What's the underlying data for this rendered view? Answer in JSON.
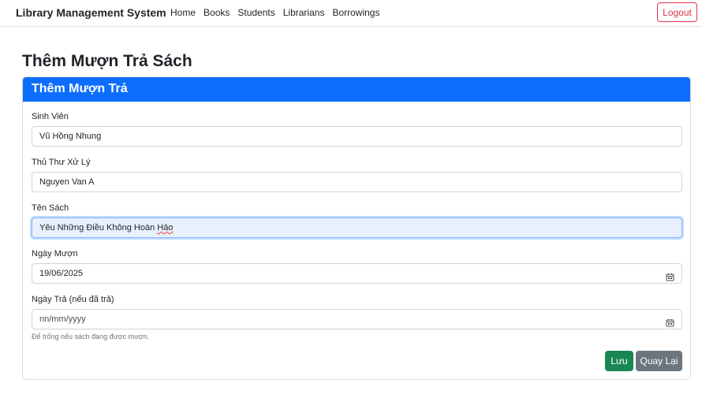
{
  "navbar": {
    "brand": "Library Management System",
    "links": [
      "Home",
      "Books",
      "Students",
      "Librarians",
      "Borrowings"
    ],
    "logout_label": "Logout"
  },
  "page": {
    "title": "Thêm Mượn Trả Sách"
  },
  "form": {
    "header": "Thêm Mượn Trả",
    "student": {
      "label": "Sinh Viên",
      "value": "Vũ Hồng Nhung"
    },
    "librarian": {
      "label": "Thủ Thư Xử Lý",
      "value": "Nguyen Van A"
    },
    "book": {
      "label": "Tên Sách",
      "value_main": "Yêu Những Điều Không Hoàn ",
      "value_misspelled": "Hảo"
    },
    "borrow_date": {
      "label": "Ngày Mượn",
      "value": "19/06/2025"
    },
    "return_date": {
      "label": "Ngày Trả (nếu đã trả)",
      "placeholder": "nn/mm/yyyy",
      "help": "Để trống nếu sách đang được mượn."
    },
    "save_label": "Lưu",
    "back_label": "Quay Lại"
  },
  "colors": {
    "primary": "#0d6efd",
    "success": "#198754",
    "secondary": "#6c757d",
    "danger": "#dc3545"
  },
  "icons": {
    "date_picker": "calendar-icon"
  }
}
